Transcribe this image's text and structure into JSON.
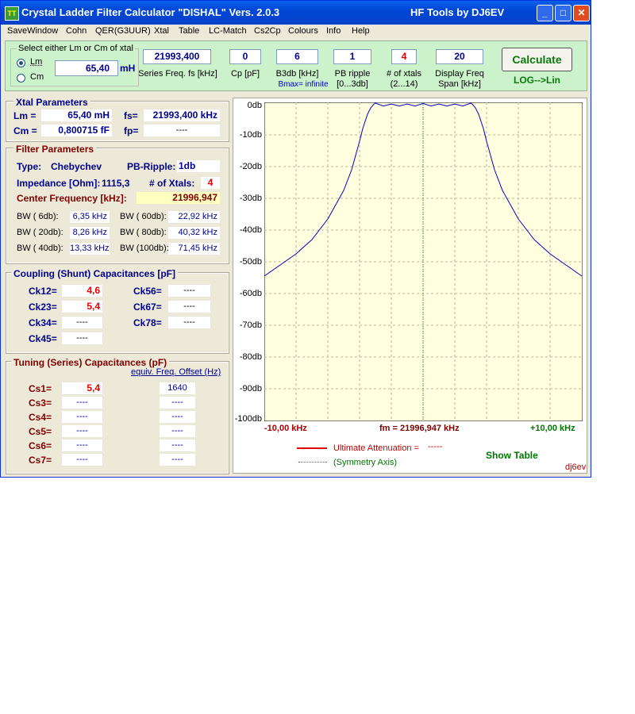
{
  "window": {
    "title": "Crystal Ladder Filter Calculator  \"DISHAL\"  Vers. 2.0.3",
    "brand": "HF Tools by DJ6EV",
    "min_glyph": "_",
    "max_glyph": "□",
    "close_glyph": "✕"
  },
  "menu": [
    "SaveWindow",
    "Cohn",
    "QER(G3UUR)",
    "Xtal",
    "Table",
    "LC-Match",
    "Cs2Cp",
    "Colours",
    "Info",
    "Help"
  ],
  "top": {
    "select_legend": "Select either Lm or Cm of xtal",
    "radio_lm": "Lm",
    "radio_cm": "Cm",
    "inductance_value": "65,40",
    "inductance_unit": "mH",
    "series_freq": {
      "value": "21993,400",
      "label": "Series Freq. fs [kHz]"
    },
    "cp": {
      "value": "0",
      "label": "Cp [pF]"
    },
    "b3db": {
      "value": "6",
      "label": "B3db [kHz]",
      "note": "Bmax= infinite"
    },
    "pb_ripple": {
      "value": "1",
      "label1": "PB ripple",
      "label2": "[0...3db]"
    },
    "num_xtals": {
      "value": "4",
      "label1": "# of xtals",
      "label2": "(2...14)"
    },
    "display_span": {
      "value": "20",
      "label1": "Display Freq",
      "label2": "Span [kHz]"
    },
    "calculate_label": "Calculate",
    "log_lin_label": "LOG-->Lin"
  },
  "xtal": {
    "title": "Xtal Parameters",
    "lm_label": "Lm =",
    "lm_value": "65,40 mH",
    "fs_label": "fs=",
    "fs_value": "21993,400 kHz",
    "cm_label": "Cm =",
    "cm_value": "0,800715  fF",
    "fp_label": "fp=",
    "fp_value": "----"
  },
  "filter": {
    "title": "Filter Parameters",
    "type_label": "Type:",
    "type_value": "Chebychev",
    "ripple_label": "PB-Ripple:",
    "ripple_value": "1db",
    "impedance_label": "Impedance [Ohm]:",
    "impedance_value": "1115,3",
    "xtals_label": "# of Xtals:",
    "xtals_value": "4",
    "center_label": "Center Frequency [kHz]:",
    "center_value": "21996,947",
    "bw": [
      {
        "label": "BW (   6db):",
        "value": "6,35 kHz"
      },
      {
        "label": "BW ( 60db):",
        "value": "22,92 kHz"
      },
      {
        "label": "BW ( 20db):",
        "value": "8,26 kHz"
      },
      {
        "label": "BW ( 80db):",
        "value": "40,32 kHz"
      },
      {
        "label": "BW ( 40db):",
        "value": "13,33 kHz"
      },
      {
        "label": "BW (100db):",
        "value": "71,45 kHz"
      }
    ]
  },
  "coupling": {
    "title": "Coupling (Shunt) Capacitances [pF]",
    "items": [
      {
        "label": "Ck12=",
        "value": "4,6"
      },
      {
        "label": "Ck23=",
        "value": "5,4"
      },
      {
        "label": "Ck34=",
        "value": "----"
      },
      {
        "label": "Ck45=",
        "value": "----"
      },
      {
        "label": "Ck56=",
        "value": "----"
      },
      {
        "label": "Ck67=",
        "value": "----"
      },
      {
        "label": "Ck78=",
        "value": "----"
      }
    ]
  },
  "tuning": {
    "title": "Tuning (Series) Capacitances (pF)",
    "offset_link": "equiv. Freq. Offset (Hz)",
    "items": [
      {
        "label": "Cs1=",
        "value": "5,4",
        "offset": "1640"
      },
      {
        "label": "Cs3=",
        "value": "----",
        "offset": "----"
      },
      {
        "label": "Cs4=",
        "value": "----",
        "offset": "----"
      },
      {
        "label": "Cs5=",
        "value": "----",
        "offset": "----"
      },
      {
        "label": "Cs6=",
        "value": "----",
        "offset": "----"
      },
      {
        "label": "Cs7=",
        "value": "----",
        "offset": "----"
      }
    ]
  },
  "plot": {
    "y_ticks": [
      "0db",
      "-10db",
      "-20db",
      "-30db",
      "-40db",
      "-50db",
      "-60db",
      "-70db",
      "-80db",
      "-90db",
      "-100db"
    ],
    "x_left": "-10,00 kHz",
    "x_center": "fm = 21996,947 kHz",
    "x_right": "+10,00 kHz",
    "legend_ultimate": "Ultimate Attenuation =",
    "legend_ultimate_value": "-----",
    "legend_symmetry": "(Symmetry Axis)",
    "show_table": "Show Table",
    "signature": "dj6ev",
    "colors": {
      "curve": "#0000CC",
      "symmetry": "#009900",
      "ultimate": "#e00000",
      "grid": "#b5b5a0",
      "bg": "#FFFFE0"
    }
  },
  "chart_data": {
    "type": "line",
    "xlim": [
      -10,
      10
    ],
    "ylim": [
      -100,
      0
    ],
    "grid": true,
    "series": [
      {
        "x": [
          -10,
          -9,
          -8,
          -7,
          -6,
          -5,
          -4.5,
          -4,
          -3.8,
          -3.5,
          -3.3,
          -3.1,
          -3.0,
          -2.5,
          -2.0,
          -1.5,
          -1.0,
          -0.5,
          0,
          0.5,
          1.0,
          1.5,
          2.0,
          2.5,
          3.0,
          3.1,
          3.3,
          3.5,
          3.8,
          4,
          4.5,
          5,
          6,
          7,
          8,
          9,
          10
        ],
        "y": [
          -54.5,
          -51,
          -47.5,
          -43,
          -36.5,
          -27.5,
          -21,
          -12,
          -8,
          -3.5,
          -1.5,
          -0.3,
          0,
          -0.9,
          -0.3,
          -0.9,
          -0.3,
          -0.9,
          -0.1,
          -0.9,
          -0.3,
          -0.9,
          -0.3,
          -0.9,
          0,
          -0.3,
          -1.5,
          -3.5,
          -8,
          -12,
          -21,
          -27.5,
          -36.5,
          -43,
          -47.5,
          -51,
          -54.5
        ]
      }
    ],
    "symmetry_axis_x": 0
  }
}
